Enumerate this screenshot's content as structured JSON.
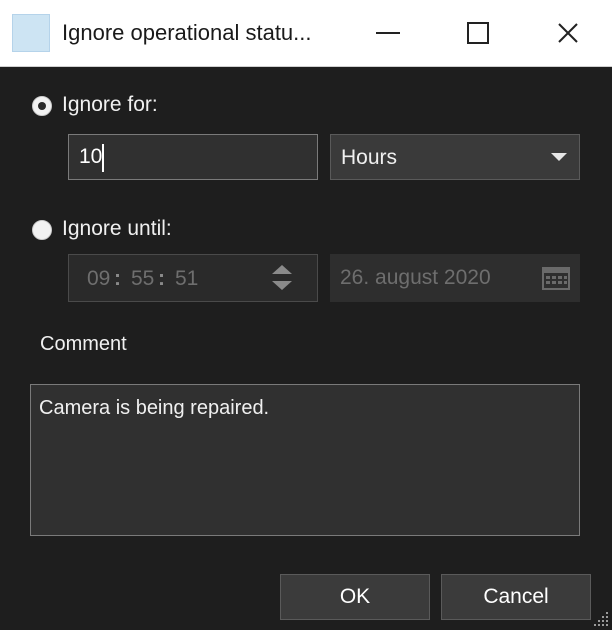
{
  "window": {
    "title": "Ignore operational statu...",
    "controls": {
      "minimize": "minimize",
      "maximize": "maximize",
      "close": "close"
    }
  },
  "ignore_for": {
    "label": "Ignore for:",
    "selected": true,
    "amount": "10",
    "unit": "Hours"
  },
  "ignore_until": {
    "label": "Ignore until:",
    "selected": false,
    "time": {
      "hours": "09",
      "minutes": "55",
      "seconds": "51",
      "separator": ":"
    },
    "date": "26. august 2020"
  },
  "comment": {
    "label": "Comment",
    "value": "Camera is being repaired."
  },
  "buttons": {
    "ok": "OK",
    "cancel": "Cancel"
  },
  "icons": {
    "app": "app-icon",
    "dropdown": "chevron-down-icon",
    "spinner": "spinner-icon",
    "calendar": "calendar-icon",
    "resize": "resize-grip-icon"
  },
  "colors": {
    "background": "#1e1e1e",
    "titlebar": "#ffffff",
    "input_bg": "#303030",
    "disabled_text": "#6e6e6e",
    "text": "#f0f0f0"
  }
}
